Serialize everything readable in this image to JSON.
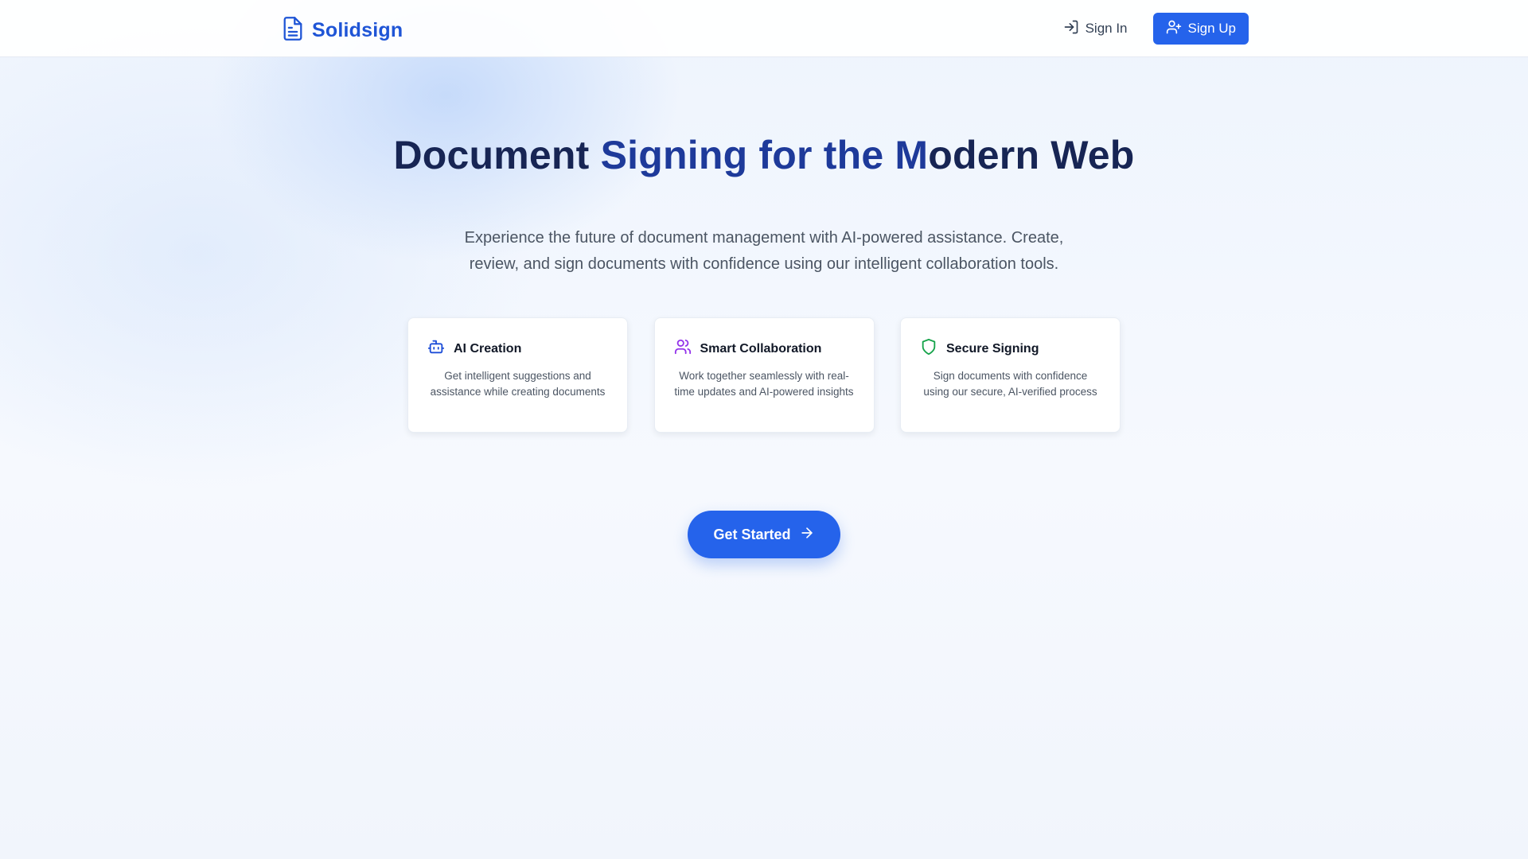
{
  "brand": {
    "name": "Solidsign",
    "icon": "file-text-icon",
    "color": "#1f55d6"
  },
  "nav": {
    "signin_label": "Sign In",
    "signin_icon": "log-in-icon",
    "signup_label": "Sign Up",
    "signup_icon": "user-plus-icon"
  },
  "hero": {
    "title_part1": "Document ",
    "title_accent": "Signing for the M",
    "title_part2": "odern Web",
    "subtitle": "Experience the future of document management with AI-powered assistance. Create, review, and sign documents with confidence using our intelligent collaboration tools."
  },
  "features": [
    {
      "title": "AI Creation",
      "description": "Get intelligent suggestions and assistance while creating documents",
      "icon": "bot-icon",
      "icon_color": "#1d4ed8"
    },
    {
      "title": "Smart Collaboration",
      "description": "Work together seamlessly with real-time updates and AI-powered insights",
      "icon": "users-icon",
      "icon_color": "#9333ea"
    },
    {
      "title": "Secure Signing",
      "description": "Sign documents with confidence using our secure, AI-verified process",
      "icon": "shield-icon",
      "icon_color": "#16a34a"
    }
  ],
  "cta": {
    "label": "Get Started",
    "icon": "arrow-right-icon"
  },
  "colors": {
    "primary": "#2563eb",
    "heading": "#172554",
    "background": "#f3f7fd"
  }
}
